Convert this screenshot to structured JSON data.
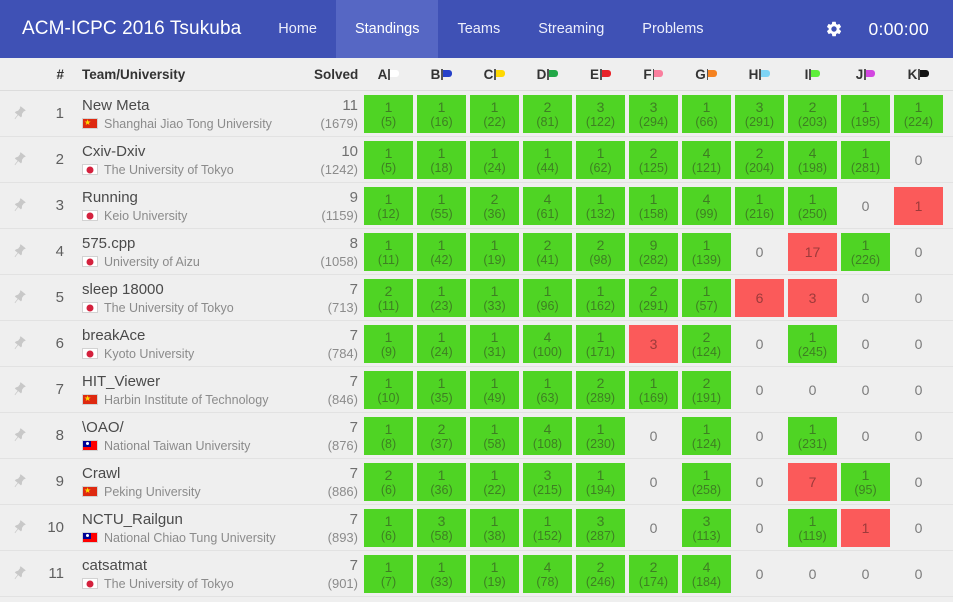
{
  "navbar": {
    "brand": "ACM-ICPC 2016 Tsukuba",
    "links": [
      {
        "label": "Home",
        "active": false
      },
      {
        "label": "Standings",
        "active": true
      },
      {
        "label": "Teams",
        "active": false
      },
      {
        "label": "Streaming",
        "active": false
      },
      {
        "label": "Problems",
        "active": false
      }
    ],
    "gear_icon": "gear-icon",
    "timer": "0:00:00",
    "bg_color": "#3f51b5",
    "active_bg_color": "#5667c4"
  },
  "table": {
    "headers": {
      "rank": "#",
      "team": "Team/University",
      "solved": "Solved"
    },
    "problems": [
      {
        "letter": "A",
        "color": "#ffffff"
      },
      {
        "letter": "B",
        "color": "#2540c8"
      },
      {
        "letter": "C",
        "color": "#ffd800"
      },
      {
        "letter": "D",
        "color": "#22a747"
      },
      {
        "letter": "E",
        "color": "#e8232a"
      },
      {
        "letter": "F",
        "color": "#fa7f9e"
      },
      {
        "letter": "G",
        "color": "#f58220"
      },
      {
        "letter": "H",
        "color": "#7fd4f5"
      },
      {
        "letter": "I",
        "color": "#5ef03a"
      },
      {
        "letter": "J",
        "color": "#d246e0"
      },
      {
        "letter": "K",
        "color": "#111111"
      }
    ],
    "colors": {
      "accepted": "#4fd424",
      "wrong": "#fb5a5a",
      "background": "#efefef"
    },
    "rows": [
      {
        "rank": "1",
        "team": "New Meta",
        "university": "Shanghai Jiao Tong University",
        "country": "cn",
        "solved": "11",
        "penalty": "(1679)",
        "cells": [
          {
            "state": "ac",
            "n": "1",
            "t": "(5)"
          },
          {
            "state": "ac",
            "n": "1",
            "t": "(16)"
          },
          {
            "state": "ac",
            "n": "1",
            "t": "(22)"
          },
          {
            "state": "ac",
            "n": "2",
            "t": "(81)"
          },
          {
            "state": "ac",
            "n": "3",
            "t": "(122)"
          },
          {
            "state": "ac",
            "n": "3",
            "t": "(294)"
          },
          {
            "state": "ac",
            "n": "1",
            "t": "(66)"
          },
          {
            "state": "ac",
            "n": "3",
            "t": "(291)"
          },
          {
            "state": "ac",
            "n": "2",
            "t": "(203)"
          },
          {
            "state": "ac",
            "n": "1",
            "t": "(195)"
          },
          {
            "state": "ac",
            "n": "1",
            "t": "(224)"
          }
        ]
      },
      {
        "rank": "2",
        "team": "Cxiv-Dxiv",
        "university": "The University of Tokyo",
        "country": "jp",
        "solved": "10",
        "penalty": "(1242)",
        "cells": [
          {
            "state": "ac",
            "n": "1",
            "t": "(5)"
          },
          {
            "state": "ac",
            "n": "1",
            "t": "(18)"
          },
          {
            "state": "ac",
            "n": "1",
            "t": "(24)"
          },
          {
            "state": "ac",
            "n": "1",
            "t": "(44)"
          },
          {
            "state": "ac",
            "n": "1",
            "t": "(62)"
          },
          {
            "state": "ac",
            "n": "2",
            "t": "(125)"
          },
          {
            "state": "ac",
            "n": "4",
            "t": "(121)"
          },
          {
            "state": "ac",
            "n": "2",
            "t": "(204)"
          },
          {
            "state": "ac",
            "n": "4",
            "t": "(198)"
          },
          {
            "state": "ac",
            "n": "1",
            "t": "(281)"
          },
          {
            "state": "none",
            "n": "0",
            "t": ""
          }
        ]
      },
      {
        "rank": "3",
        "team": "Running",
        "university": "Keio University",
        "country": "jp",
        "solved": "9",
        "penalty": "(1159)",
        "cells": [
          {
            "state": "ac",
            "n": "1",
            "t": "(12)"
          },
          {
            "state": "ac",
            "n": "1",
            "t": "(55)"
          },
          {
            "state": "ac",
            "n": "2",
            "t": "(36)"
          },
          {
            "state": "ac",
            "n": "4",
            "t": "(61)"
          },
          {
            "state": "ac",
            "n": "1",
            "t": "(132)"
          },
          {
            "state": "ac",
            "n": "1",
            "t": "(158)"
          },
          {
            "state": "ac",
            "n": "4",
            "t": "(99)"
          },
          {
            "state": "ac",
            "n": "1",
            "t": "(216)"
          },
          {
            "state": "ac",
            "n": "1",
            "t": "(250)"
          },
          {
            "state": "none",
            "n": "0",
            "t": ""
          },
          {
            "state": "wa",
            "n": "1",
            "t": ""
          }
        ]
      },
      {
        "rank": "4",
        "team": "575.cpp",
        "university": "University of Aizu",
        "country": "jp",
        "solved": "8",
        "penalty": "(1058)",
        "cells": [
          {
            "state": "ac",
            "n": "1",
            "t": "(11)"
          },
          {
            "state": "ac",
            "n": "1",
            "t": "(42)"
          },
          {
            "state": "ac",
            "n": "1",
            "t": "(19)"
          },
          {
            "state": "ac",
            "n": "2",
            "t": "(41)"
          },
          {
            "state": "ac",
            "n": "2",
            "t": "(98)"
          },
          {
            "state": "ac",
            "n": "9",
            "t": "(282)"
          },
          {
            "state": "ac",
            "n": "1",
            "t": "(139)"
          },
          {
            "state": "none",
            "n": "0",
            "t": ""
          },
          {
            "state": "wa",
            "n": "17",
            "t": ""
          },
          {
            "state": "ac",
            "n": "1",
            "t": "(226)"
          },
          {
            "state": "none",
            "n": "0",
            "t": ""
          }
        ]
      },
      {
        "rank": "5",
        "team": "sleep 18000",
        "university": "The University of Tokyo",
        "country": "jp",
        "solved": "7",
        "penalty": "(713)",
        "cells": [
          {
            "state": "ac",
            "n": "2",
            "t": "(11)"
          },
          {
            "state": "ac",
            "n": "1",
            "t": "(23)"
          },
          {
            "state": "ac",
            "n": "1",
            "t": "(33)"
          },
          {
            "state": "ac",
            "n": "1",
            "t": "(96)"
          },
          {
            "state": "ac",
            "n": "1",
            "t": "(162)"
          },
          {
            "state": "ac",
            "n": "2",
            "t": "(291)"
          },
          {
            "state": "ac",
            "n": "1",
            "t": "(57)"
          },
          {
            "state": "wa",
            "n": "6",
            "t": ""
          },
          {
            "state": "wa",
            "n": "3",
            "t": ""
          },
          {
            "state": "none",
            "n": "0",
            "t": ""
          },
          {
            "state": "none",
            "n": "0",
            "t": ""
          }
        ]
      },
      {
        "rank": "6",
        "team": "breakAce",
        "university": "Kyoto University",
        "country": "jp",
        "solved": "7",
        "penalty": "(784)",
        "cells": [
          {
            "state": "ac",
            "n": "1",
            "t": "(9)"
          },
          {
            "state": "ac",
            "n": "1",
            "t": "(24)"
          },
          {
            "state": "ac",
            "n": "1",
            "t": "(31)"
          },
          {
            "state": "ac",
            "n": "4",
            "t": "(100)"
          },
          {
            "state": "ac",
            "n": "1",
            "t": "(171)"
          },
          {
            "state": "wa",
            "n": "3",
            "t": ""
          },
          {
            "state": "ac",
            "n": "2",
            "t": "(124)"
          },
          {
            "state": "none",
            "n": "0",
            "t": ""
          },
          {
            "state": "ac",
            "n": "1",
            "t": "(245)"
          },
          {
            "state": "none",
            "n": "0",
            "t": ""
          },
          {
            "state": "none",
            "n": "0",
            "t": ""
          }
        ]
      },
      {
        "rank": "7",
        "team": "HIT_Viewer",
        "university": "Harbin Institute of Technology",
        "country": "cn",
        "solved": "7",
        "penalty": "(846)",
        "cells": [
          {
            "state": "ac",
            "n": "1",
            "t": "(10)"
          },
          {
            "state": "ac",
            "n": "1",
            "t": "(35)"
          },
          {
            "state": "ac",
            "n": "1",
            "t": "(49)"
          },
          {
            "state": "ac",
            "n": "1",
            "t": "(63)"
          },
          {
            "state": "ac",
            "n": "2",
            "t": "(289)"
          },
          {
            "state": "ac",
            "n": "1",
            "t": "(169)"
          },
          {
            "state": "ac",
            "n": "2",
            "t": "(191)"
          },
          {
            "state": "none",
            "n": "0",
            "t": ""
          },
          {
            "state": "none",
            "n": "0",
            "t": ""
          },
          {
            "state": "none",
            "n": "0",
            "t": ""
          },
          {
            "state": "none",
            "n": "0",
            "t": ""
          }
        ]
      },
      {
        "rank": "8",
        "team": "\\OAO/",
        "university": "National Taiwan University",
        "country": "tw",
        "solved": "7",
        "penalty": "(876)",
        "cells": [
          {
            "state": "ac",
            "n": "1",
            "t": "(8)"
          },
          {
            "state": "ac",
            "n": "2",
            "t": "(37)"
          },
          {
            "state": "ac",
            "n": "1",
            "t": "(58)"
          },
          {
            "state": "ac",
            "n": "4",
            "t": "(108)"
          },
          {
            "state": "ac",
            "n": "1",
            "t": "(230)"
          },
          {
            "state": "none",
            "n": "0",
            "t": ""
          },
          {
            "state": "ac",
            "n": "1",
            "t": "(124)"
          },
          {
            "state": "none",
            "n": "0",
            "t": ""
          },
          {
            "state": "ac",
            "n": "1",
            "t": "(231)"
          },
          {
            "state": "none",
            "n": "0",
            "t": ""
          },
          {
            "state": "none",
            "n": "0",
            "t": ""
          }
        ]
      },
      {
        "rank": "9",
        "team": "Crawl",
        "university": "Peking University",
        "country": "cn",
        "solved": "7",
        "penalty": "(886)",
        "cells": [
          {
            "state": "ac",
            "n": "2",
            "t": "(6)"
          },
          {
            "state": "ac",
            "n": "1",
            "t": "(36)"
          },
          {
            "state": "ac",
            "n": "1",
            "t": "(22)"
          },
          {
            "state": "ac",
            "n": "3",
            "t": "(215)"
          },
          {
            "state": "ac",
            "n": "1",
            "t": "(194)"
          },
          {
            "state": "none",
            "n": "0",
            "t": ""
          },
          {
            "state": "ac",
            "n": "1",
            "t": "(258)"
          },
          {
            "state": "none",
            "n": "0",
            "t": ""
          },
          {
            "state": "wa",
            "n": "7",
            "t": ""
          },
          {
            "state": "ac",
            "n": "1",
            "t": "(95)"
          },
          {
            "state": "none",
            "n": "0",
            "t": ""
          }
        ]
      },
      {
        "rank": "10",
        "team": "NCTU_Railgun",
        "university": "National Chiao Tung University",
        "country": "tw",
        "solved": "7",
        "penalty": "(893)",
        "cells": [
          {
            "state": "ac",
            "n": "1",
            "t": "(6)"
          },
          {
            "state": "ac",
            "n": "3",
            "t": "(58)"
          },
          {
            "state": "ac",
            "n": "1",
            "t": "(38)"
          },
          {
            "state": "ac",
            "n": "1",
            "t": "(152)"
          },
          {
            "state": "ac",
            "n": "3",
            "t": "(287)"
          },
          {
            "state": "none",
            "n": "0",
            "t": ""
          },
          {
            "state": "ac",
            "n": "3",
            "t": "(113)"
          },
          {
            "state": "none",
            "n": "0",
            "t": ""
          },
          {
            "state": "ac",
            "n": "1",
            "t": "(119)"
          },
          {
            "state": "wa",
            "n": "1",
            "t": ""
          },
          {
            "state": "none",
            "n": "0",
            "t": ""
          }
        ]
      },
      {
        "rank": "11",
        "team": "catsatmat",
        "university": "The University of Tokyo",
        "country": "jp",
        "solved": "7",
        "penalty": "(901)",
        "cells": [
          {
            "state": "ac",
            "n": "1",
            "t": "(7)"
          },
          {
            "state": "ac",
            "n": "1",
            "t": "(33)"
          },
          {
            "state": "ac",
            "n": "1",
            "t": "(19)"
          },
          {
            "state": "ac",
            "n": "4",
            "t": "(78)"
          },
          {
            "state": "ac",
            "n": "2",
            "t": "(246)"
          },
          {
            "state": "ac",
            "n": "2",
            "t": "(174)"
          },
          {
            "state": "ac",
            "n": "4",
            "t": "(184)"
          },
          {
            "state": "none",
            "n": "0",
            "t": ""
          },
          {
            "state": "none",
            "n": "0",
            "t": ""
          },
          {
            "state": "none",
            "n": "0",
            "t": ""
          },
          {
            "state": "none",
            "n": "0",
            "t": ""
          }
        ]
      }
    ]
  }
}
